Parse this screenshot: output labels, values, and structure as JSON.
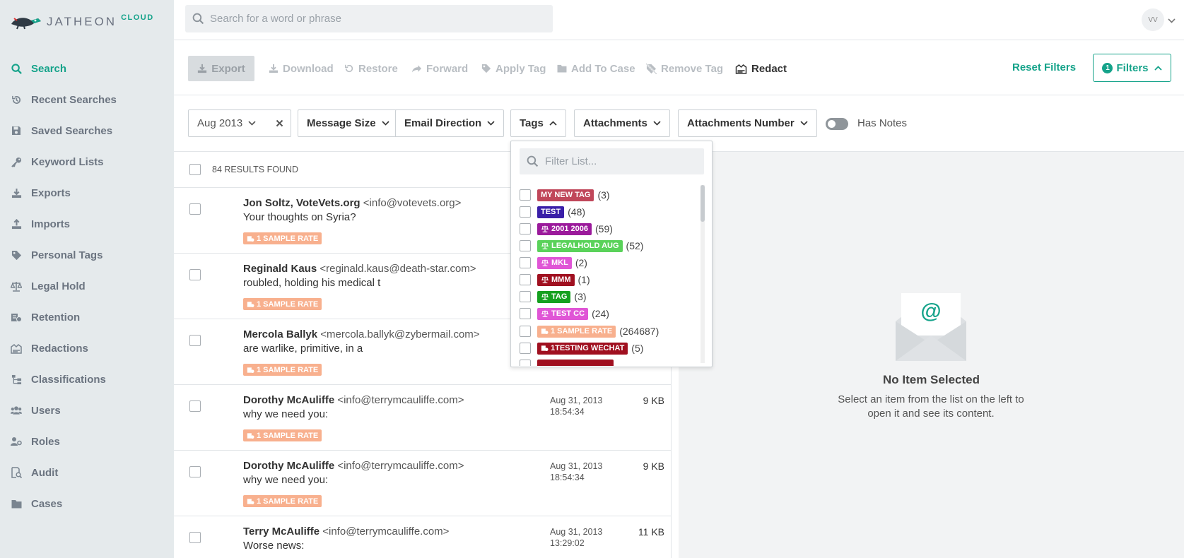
{
  "app": {
    "brand": "JATHEON",
    "brand_suffix": "CLOUD"
  },
  "sidebar": {
    "items": [
      {
        "label": "Search",
        "icon": "search-icon",
        "active": true
      },
      {
        "label": "Recent Searches",
        "icon": "history-icon"
      },
      {
        "label": "Saved Searches",
        "icon": "save-icon"
      },
      {
        "label": "Keyword Lists",
        "icon": "key-icon"
      },
      {
        "label": "Exports",
        "icon": "download-icon"
      },
      {
        "label": "Imports",
        "icon": "upload-icon"
      },
      {
        "label": "Personal Tags",
        "icon": "tag-icon"
      },
      {
        "label": "Legal Hold",
        "icon": "scale-icon"
      },
      {
        "label": "Retention",
        "icon": "retention-icon"
      },
      {
        "label": "Redactions",
        "icon": "redaction-icon"
      },
      {
        "label": "Classifications",
        "icon": "classification-icon"
      },
      {
        "label": "Users",
        "icon": "users-icon"
      },
      {
        "label": "Roles",
        "icon": "roles-icon"
      },
      {
        "label": "Audit",
        "icon": "audit-icon"
      },
      {
        "label": "Cases",
        "icon": "folder-icon"
      }
    ]
  },
  "topbar": {
    "search_placeholder": "Search for a word or phrase",
    "avatar_initials": "VV"
  },
  "toolbar": {
    "export": "Export",
    "download": "Download",
    "restore": "Restore",
    "forward": "Forward",
    "apply_tag": "Apply Tag",
    "add_to_case": "Add To Case",
    "remove_tag": "Remove Tag",
    "redact": "Redact",
    "reset_filters": "Reset Filters",
    "filters_count": "1",
    "filters": "Filters"
  },
  "filters": {
    "date": "Aug 2013",
    "message_size": "Message Size",
    "email_direction": "Email Direction",
    "tags": "Tags",
    "attachments": "Attachments",
    "attachments_number": "Attachments Number",
    "has_notes": "Has Notes"
  },
  "results": {
    "count_label": "84 RESULTS FOUND",
    "rows": [
      {
        "name": "Jon Soltz, VoteVets.org",
        "addr": "<info@votevets.org>",
        "subject": "Your thoughts on Syria?",
        "tag": "1 SAMPLE RATE",
        "date": "",
        "time": "",
        "size": ""
      },
      {
        "name": "Reginald Kaus",
        "addr": "<reginald.kaus@death-star.com>",
        "subject": "roubled, holding his medical t",
        "tag": "1 SAMPLE RATE",
        "date": "",
        "time": "",
        "size": ""
      },
      {
        "name": "Mercola Ballyk",
        "addr": "<mercola.ballyk@zybermail.com>",
        "subject": "are warlike, primitive, in a",
        "tag": "1 SAMPLE RATE",
        "date": "",
        "time": "",
        "size": ""
      },
      {
        "name": "Dorothy McAuliffe",
        "addr": "<info@terrymcauliffe.com>",
        "subject": "why we need you:",
        "tag": "1 SAMPLE RATE",
        "date": "Aug 31, 2013",
        "time": "18:54:34",
        "size": "9 KB"
      },
      {
        "name": "Dorothy McAuliffe",
        "addr": "<info@terrymcauliffe.com>",
        "subject": "why we need you:",
        "tag": "1 SAMPLE RATE",
        "date": "Aug 31, 2013",
        "time": "18:54:34",
        "size": "9 KB"
      },
      {
        "name": "Terry McAuliffe",
        "addr": "<info@terrymcauliffe.com>",
        "subject": "Worse news:",
        "tag": "",
        "date": "Aug 31, 2013",
        "time": "13:29:02",
        "size": "11 KB"
      }
    ]
  },
  "tags_dropdown": {
    "placeholder": "Filter List...",
    "items": [
      {
        "label": "MY NEW TAG",
        "count": "(3)",
        "color": "#c0475a",
        "icon": ""
      },
      {
        "label": "TEST",
        "count": "(48)",
        "color": "#3a1fa8",
        "icon": ""
      },
      {
        "label": "2001 2006",
        "count": "(59)",
        "color": "#9b1a9b",
        "icon": "scale-icon"
      },
      {
        "label": "LEGALHOLD AUG",
        "count": "(52)",
        "color": "#5ad25a",
        "icon": "scale-icon"
      },
      {
        "label": "MKL",
        "count": "(2)",
        "color": "#e055d6",
        "icon": "scale-icon"
      },
      {
        "label": "MMM",
        "count": "(1)",
        "color": "#a01020",
        "icon": "scale-icon"
      },
      {
        "label": "TAG",
        "count": "(3)",
        "color": "#15a020",
        "icon": "scale-icon"
      },
      {
        "label": "TEST CC",
        "count": "(24)",
        "color": "#e055d6",
        "icon": "scale-icon"
      },
      {
        "label": "1 SAMPLE RATE",
        "count": "(264687)",
        "color": "#f8b08e",
        "icon": "retention-icon"
      },
      {
        "label": "1TESTING WECHAT",
        "count": "(5)",
        "color": "#a01020",
        "icon": "retention-icon"
      }
    ]
  },
  "preview": {
    "title": "No Item Selected",
    "description": "Select an item from the list on the left to open it and see its content."
  },
  "colors": {
    "accent": "#15a38a",
    "sidebar_bg": "#e5eaec"
  }
}
